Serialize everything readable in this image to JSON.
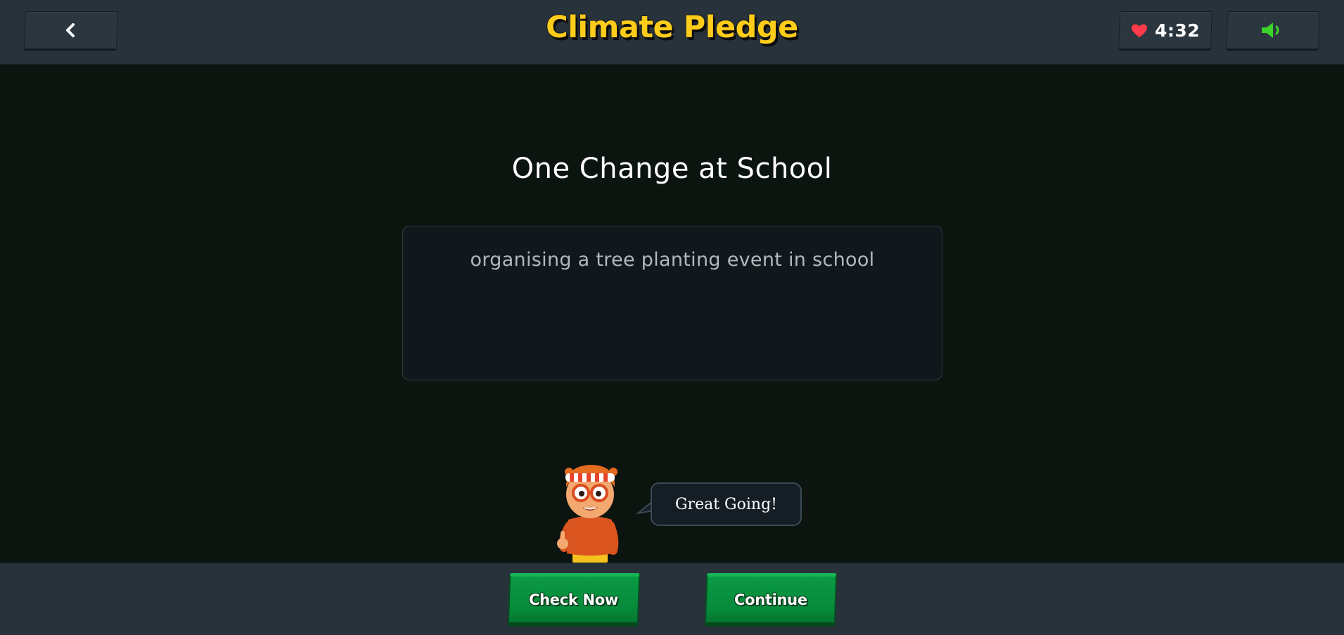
{
  "header": {
    "title": "Climate Pledge",
    "timer": "4:32",
    "back_icon": "chevron-left-icon",
    "heart_icon": "heart-icon",
    "sound_icon": "speaker-icon"
  },
  "main": {
    "prompt_title": "One Change at School",
    "answer_text": "organising a tree planting event in school"
  },
  "mascot": {
    "speech": "Great Going!"
  },
  "footer": {
    "check_label": "Check Now",
    "continue_label": "Continue"
  },
  "colors": {
    "title": "#ffcc1a",
    "heart": "#ff3b4a",
    "sound": "#39d42a",
    "button_green": "#078a3b",
    "background": "#0b140f",
    "bar": "#28323a"
  }
}
